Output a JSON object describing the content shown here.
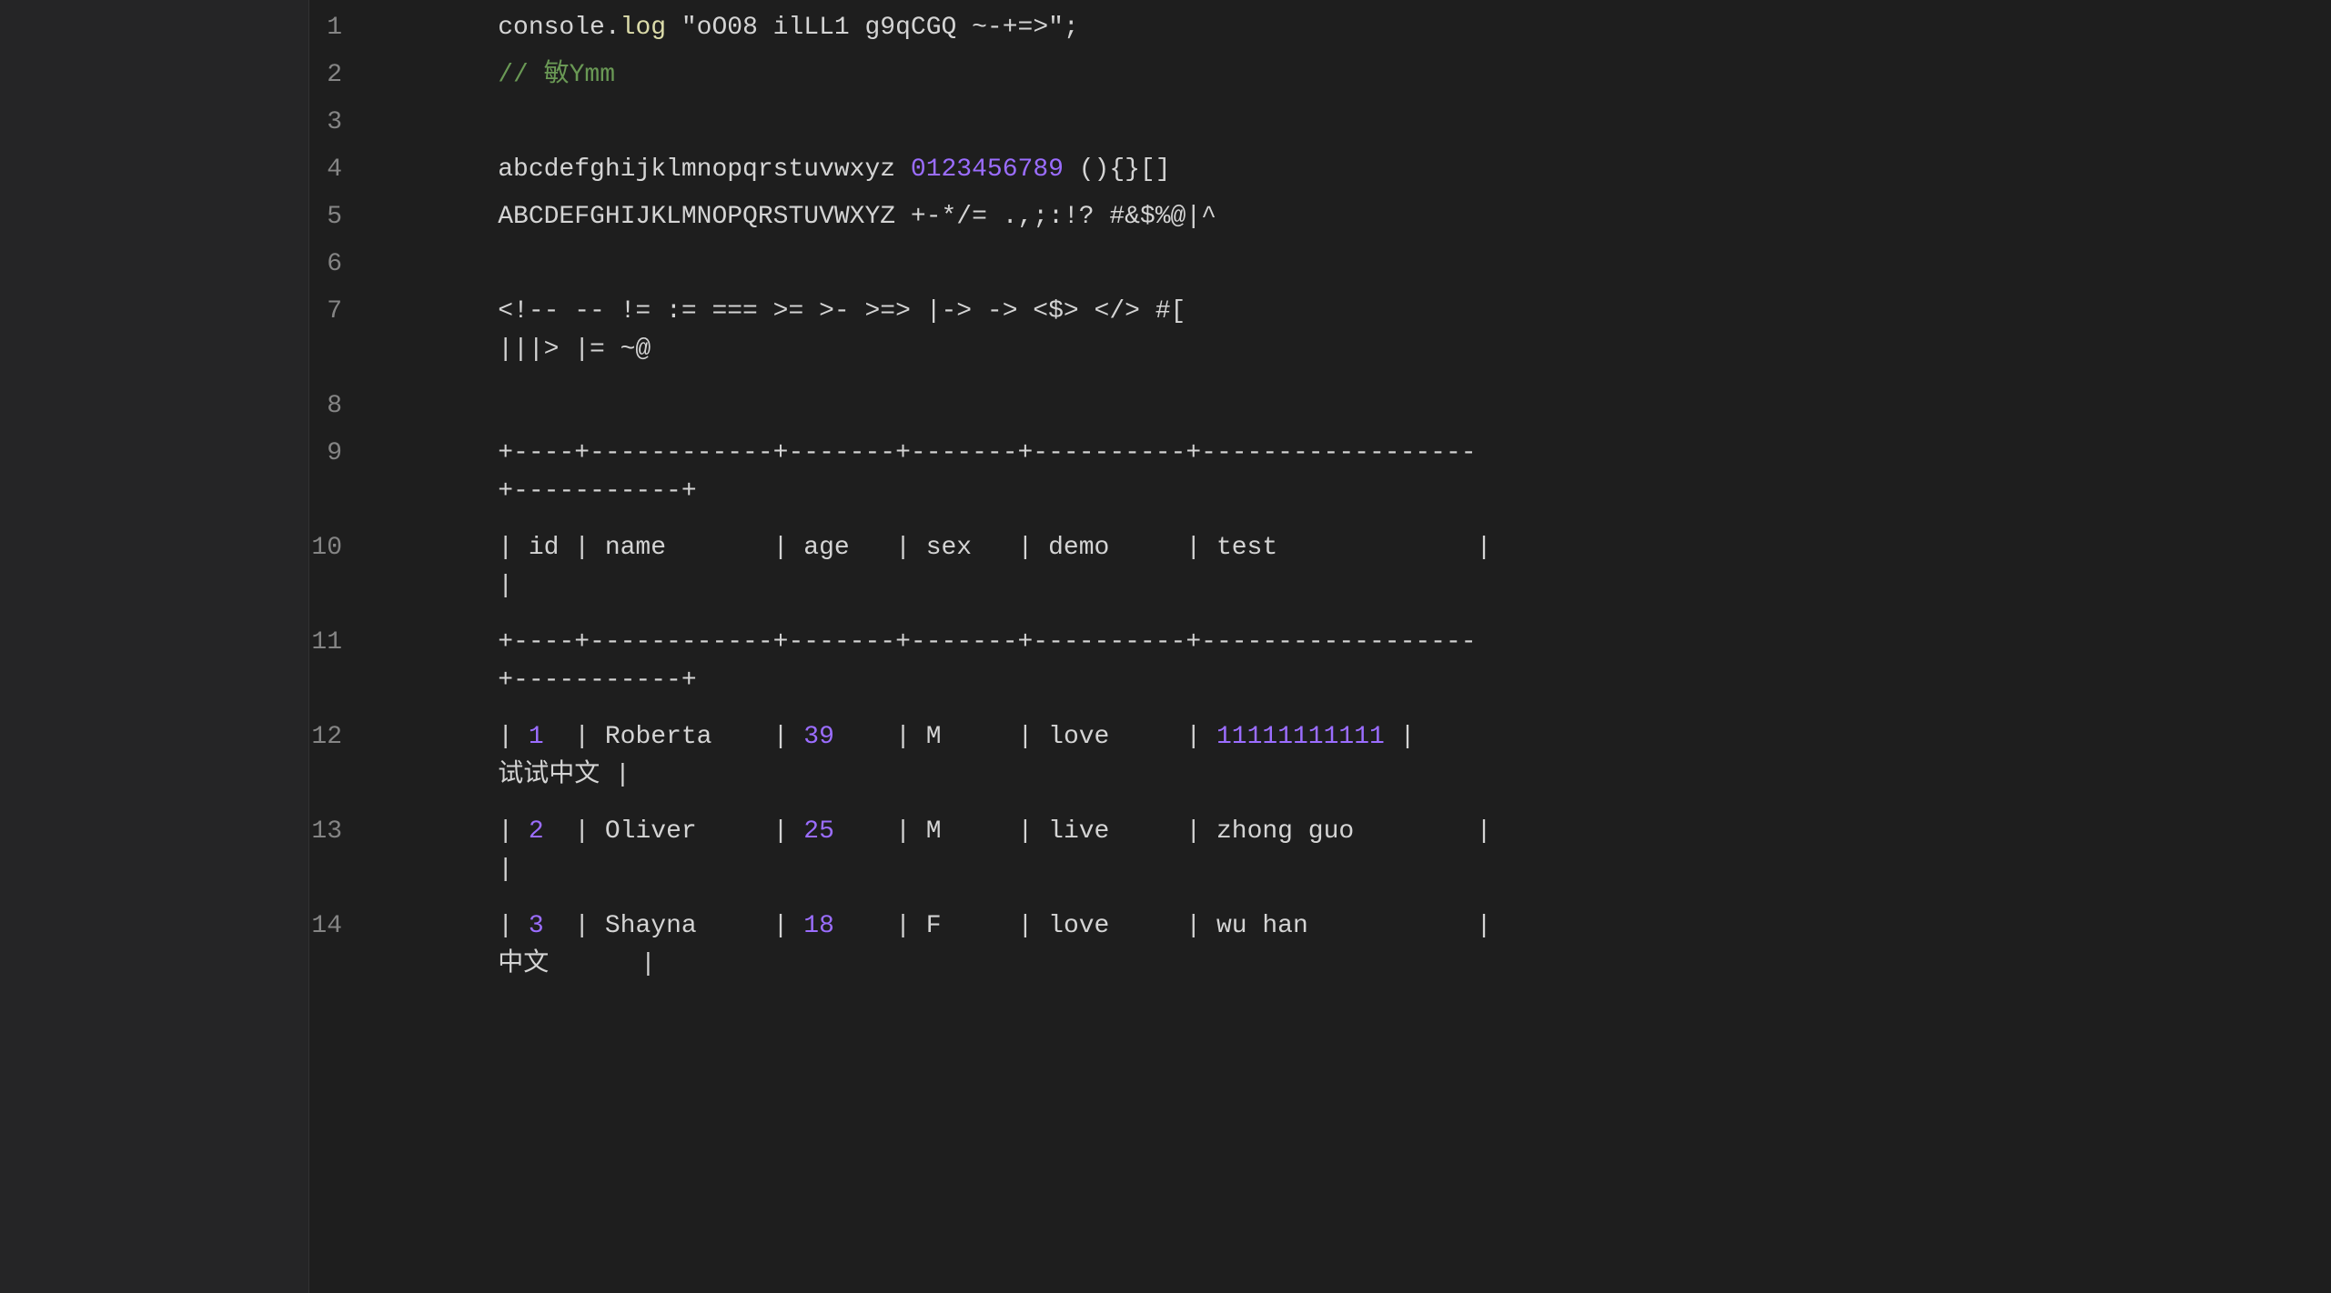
{
  "editor": {
    "background": "#1e1e1e",
    "lines": [
      {
        "number": "1",
        "parts": [
          {
            "text": "    console.",
            "color": "white"
          },
          {
            "text": "log",
            "color": "yellow"
          },
          {
            "text": " \"oO08 ilLL1 g9qCGQ ~-+=>\"",
            "color": "white"
          },
          {
            "text": ";",
            "color": "white"
          }
        ]
      },
      {
        "number": "2",
        "parts": [
          {
            "text": "    ",
            "color": "white"
          },
          {
            "text": "// 敏Ymm",
            "color": "green"
          }
        ]
      },
      {
        "number": "3",
        "parts": []
      },
      {
        "number": "4",
        "parts": [
          {
            "text": "    abcdefghijklmnopqrstuvwxyz ",
            "color": "white"
          },
          {
            "text": "0123456789",
            "color": "purple3"
          },
          {
            "text": " (){}[]",
            "color": "white"
          }
        ]
      },
      {
        "number": "5",
        "parts": [
          {
            "text": "    ABCDEFGHIJKLMNOPQRSTUVWXYZ +-*/= .,;:!? #&$%@|^",
            "color": "white"
          }
        ]
      },
      {
        "number": "6",
        "parts": []
      },
      {
        "number": "7",
        "parts": [
          {
            "text": "    <!-- -- != := === >= >- >=> |-> -> <$> </> #[\n    |||> |= ~@",
            "color": "white"
          }
        ]
      },
      {
        "number": "8",
        "parts": []
      },
      {
        "number": "9",
        "parts": [
          {
            "text": "    +----+------------+-------+-------+----------+------------------\n    +-----------+",
            "color": "white"
          }
        ]
      },
      {
        "number": "10",
        "parts": [
          {
            "text": "    | id | name       | age   | sex   | demo     | test             |\n    |",
            "color": "white"
          }
        ]
      },
      {
        "number": "11",
        "parts": [
          {
            "text": "    +----+------------+-------+-------+----------+------------------\n    +-----------+",
            "color": "white"
          }
        ]
      },
      {
        "number": "12",
        "parts": [
          {
            "text": "    | ",
            "color": "white"
          },
          {
            "text": "1",
            "color": "purple3"
          },
          {
            "text": "  | Roberta    | ",
            "color": "white"
          },
          {
            "text": "39",
            "color": "purple3"
          },
          {
            "text": "    | M     | love     | ",
            "color": "white"
          },
          {
            "text": "11111111111",
            "color": "purple3"
          },
          {
            "text": " |\n    试试中文 |",
            "color": "white"
          }
        ]
      },
      {
        "number": "13",
        "parts": [
          {
            "text": "    | ",
            "color": "white"
          },
          {
            "text": "2",
            "color": "purple3"
          },
          {
            "text": "  | Oliver     | ",
            "color": "white"
          },
          {
            "text": "25",
            "color": "purple3"
          },
          {
            "text": "    | M     | live     | zhong guo        |\n    |",
            "color": "white"
          }
        ]
      },
      {
        "number": "14",
        "parts": [
          {
            "text": "    | ",
            "color": "white"
          },
          {
            "text": "3",
            "color": "purple3"
          },
          {
            "text": "  | Shayna     | ",
            "color": "white"
          },
          {
            "text": "18",
            "color": "purple3"
          },
          {
            "text": "    | F     | love     | wu han           |\n    中文      |",
            "color": "white"
          }
        ]
      }
    ]
  }
}
